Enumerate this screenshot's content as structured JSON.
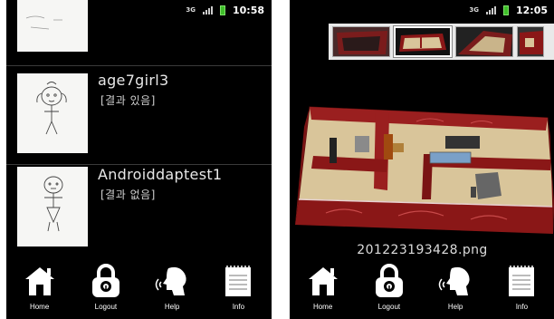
{
  "left": {
    "status": {
      "network": "3G",
      "time": "10:58"
    },
    "rows": [
      {
        "title": "age7girl3",
        "subtitle": "[결과 있음]"
      },
      {
        "title": "Androiddaptest1",
        "subtitle": "[결과 없음]"
      }
    ],
    "nav": {
      "home": "Home",
      "logout": "Logout",
      "help": "Help",
      "info": "Info"
    }
  },
  "right": {
    "status": {
      "network": "3G",
      "time": "12:05"
    },
    "filename": "201223193428.png",
    "nav": {
      "home": "Home",
      "logout": "Logout",
      "help": "Help",
      "info": "Info"
    }
  },
  "colors": {
    "wall": "#8a1717",
    "floor": "#d9c59a",
    "battery": "#3fbf2a"
  }
}
